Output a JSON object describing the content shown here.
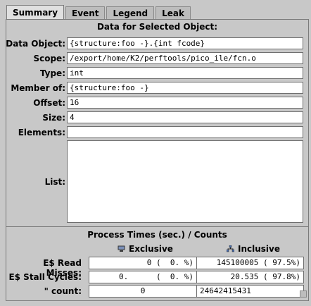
{
  "tabs": [
    {
      "label": "Summary",
      "active": true
    },
    {
      "label": "Event",
      "active": false
    },
    {
      "label": "Legend",
      "active": false
    },
    {
      "label": "Leak",
      "active": false
    }
  ],
  "object_section": {
    "title": "Data for Selected Object:",
    "fields": [
      {
        "label": "Data Object:",
        "value": "{structure:foo -}.{int fcode}"
      },
      {
        "label": "Scope:",
        "value": "/export/home/K2/perftools/pico_ile/fcn.o"
      },
      {
        "label": "Type:",
        "value": "int"
      },
      {
        "label": "Member of:",
        "value": "{structure:foo -}"
      },
      {
        "label": "Offset:",
        "value": "16"
      },
      {
        "label": "Size:",
        "value": "4"
      },
      {
        "label": "Elements:",
        "value": ""
      }
    ],
    "list_label": "List:"
  },
  "metrics_section": {
    "title": "Process Times (sec.) / Counts",
    "exclusive_header": "Exclusive",
    "inclusive_header": "Inclusive",
    "rows": [
      {
        "label": "E$ Read Misses:",
        "exclusive": "0 (  0. %)",
        "inclusive": "145100005 ( 97.5%)"
      },
      {
        "label": "E$ Stall Cycles:",
        "exclusive": "0.      (  0. %)",
        "inclusive": "20.535 ( 97.8%)"
      },
      {
        "label": "\" count:",
        "exclusive": "0",
        "inclusive": "24642415431"
      }
    ]
  },
  "colors": {
    "background": "#c8c8c8",
    "field_background": "#ffffff",
    "border": "#7a7a7a"
  }
}
